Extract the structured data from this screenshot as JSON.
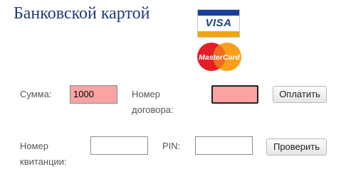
{
  "header": {
    "title": "Банковской картой"
  },
  "logos": {
    "visa_text": "VISA",
    "mastercard_text": "MasterCard"
  },
  "payment": {
    "amount_label": "Сумма:",
    "amount_value": "1000",
    "contract_label_line1": "Номер",
    "contract_label_line2": "договора:",
    "contract_value": "",
    "pay_button": "Оплатить"
  },
  "check": {
    "receipt_label_line1": "Номер",
    "receipt_label_line2": "квитанции:",
    "receipt_value": "",
    "pin_label": "PIN:",
    "pin_value": "",
    "check_button": "Проверить"
  },
  "colors": {
    "title": "#1f3b78",
    "invalid_field": "#f9a3a3",
    "visa_blue": "#1a3e9a",
    "visa_gold": "#f0a410",
    "mc_red": "#e41e26",
    "mc_orange": "#f8a01b"
  }
}
